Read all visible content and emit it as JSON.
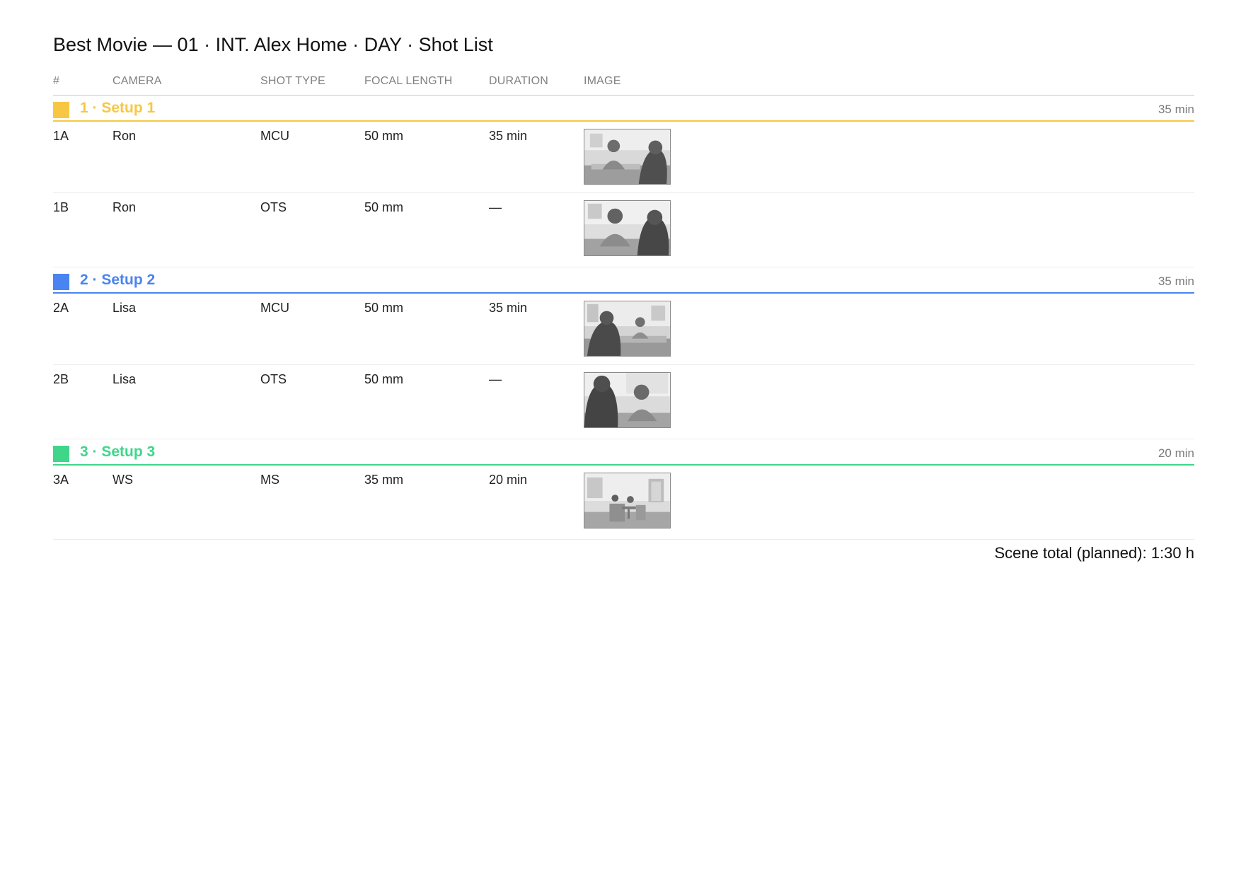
{
  "title": "Best Movie — 01 · INT. Alex Home · DAY · Shot List",
  "columns": {
    "num": "#",
    "camera": "CAMERA",
    "shot_type": "SHOT TYPE",
    "focal_length": "FOCAL LENGTH",
    "duration": "DURATION",
    "image": "IMAGE"
  },
  "groups": [
    {
      "label": "1 · Setup 1",
      "total": "35 min",
      "color": "#f7c744",
      "shots": [
        {
          "id": "1A",
          "camera": "Ron",
          "shot_type": "MCU",
          "focal_length": "50 mm",
          "duration": "35 min",
          "image_icon": "storyboard-man-facing-woman-icon"
        },
        {
          "id": "1B",
          "camera": "Ron",
          "shot_type": "OTS",
          "focal_length": "50 mm",
          "duration": "—",
          "image_icon": "storyboard-over-shoulder-man-icon"
        }
      ]
    },
    {
      "label": "2 · Setup 2",
      "total": "35 min",
      "color": "#4a84f0",
      "shots": [
        {
          "id": "2A",
          "camera": "Lisa",
          "shot_type": "MCU",
          "focal_length": "50 mm",
          "duration": "35 min",
          "image_icon": "storyboard-woman-at-table-icon"
        },
        {
          "id": "2B",
          "camera": "Lisa",
          "shot_type": "OTS",
          "focal_length": "50 mm",
          "duration": "—",
          "image_icon": "storyboard-over-shoulder-woman-icon"
        }
      ]
    },
    {
      "label": "3 · Setup 3",
      "total": "20 min",
      "color": "#3fd68a",
      "shots": [
        {
          "id": "3A",
          "camera": "WS",
          "shot_type": "MS",
          "focal_length": "35 mm",
          "duration": "20 min",
          "image_icon": "storyboard-wide-room-icon"
        }
      ]
    }
  ],
  "scene_total": "Scene total (planned): 1:30 h"
}
